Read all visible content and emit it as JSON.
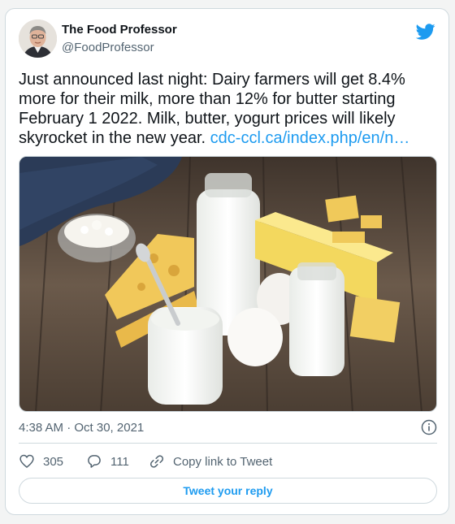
{
  "author": {
    "name": "The Food Professor",
    "handle": "@FoodProfessor"
  },
  "tweet": {
    "text": "Just announced last night: Dairy farmers will get 8.4% more for their milk, more than 12% for butter starting February 1 2022. Milk, butter, yogurt prices will likely skyrocket in the new year.",
    "link_text": "cdc-ccl.ca/index.php/en/n…"
  },
  "meta": {
    "time": "4:38 AM · Oct 30, 2021"
  },
  "actions": {
    "likes": "305",
    "replies": "111",
    "copy_link": "Copy link to Tweet"
  },
  "reply_button": "Tweet your reply",
  "colors": {
    "accent": "#1d9bf0",
    "text": "#0f1419",
    "muted": "#536471",
    "border": "#cfd9de"
  },
  "icons": [
    "twitter-bird-icon",
    "info-icon",
    "heart-icon",
    "reply-icon",
    "link-icon"
  ]
}
